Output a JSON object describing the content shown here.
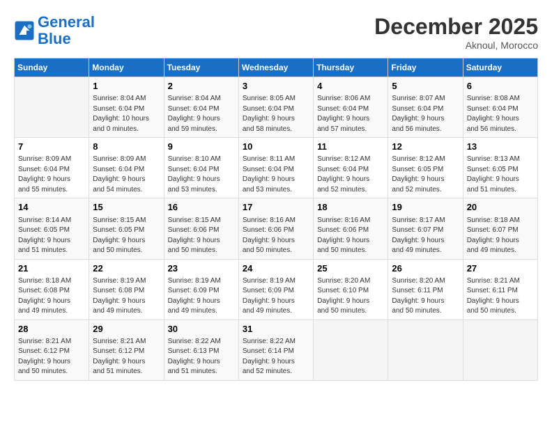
{
  "header": {
    "logo_line1": "General",
    "logo_line2": "Blue",
    "month": "December 2025",
    "location": "Aknoul, Morocco"
  },
  "days_of_week": [
    "Sunday",
    "Monday",
    "Tuesday",
    "Wednesday",
    "Thursday",
    "Friday",
    "Saturday"
  ],
  "weeks": [
    [
      {
        "num": "",
        "info": ""
      },
      {
        "num": "1",
        "info": "Sunrise: 8:04 AM\nSunset: 6:04 PM\nDaylight: 10 hours\nand 0 minutes."
      },
      {
        "num": "2",
        "info": "Sunrise: 8:04 AM\nSunset: 6:04 PM\nDaylight: 9 hours\nand 59 minutes."
      },
      {
        "num": "3",
        "info": "Sunrise: 8:05 AM\nSunset: 6:04 PM\nDaylight: 9 hours\nand 58 minutes."
      },
      {
        "num": "4",
        "info": "Sunrise: 8:06 AM\nSunset: 6:04 PM\nDaylight: 9 hours\nand 57 minutes."
      },
      {
        "num": "5",
        "info": "Sunrise: 8:07 AM\nSunset: 6:04 PM\nDaylight: 9 hours\nand 56 minutes."
      },
      {
        "num": "6",
        "info": "Sunrise: 8:08 AM\nSunset: 6:04 PM\nDaylight: 9 hours\nand 56 minutes."
      }
    ],
    [
      {
        "num": "7",
        "info": "Sunrise: 8:09 AM\nSunset: 6:04 PM\nDaylight: 9 hours\nand 55 minutes."
      },
      {
        "num": "8",
        "info": "Sunrise: 8:09 AM\nSunset: 6:04 PM\nDaylight: 9 hours\nand 54 minutes."
      },
      {
        "num": "9",
        "info": "Sunrise: 8:10 AM\nSunset: 6:04 PM\nDaylight: 9 hours\nand 53 minutes."
      },
      {
        "num": "10",
        "info": "Sunrise: 8:11 AM\nSunset: 6:04 PM\nDaylight: 9 hours\nand 53 minutes."
      },
      {
        "num": "11",
        "info": "Sunrise: 8:12 AM\nSunset: 6:04 PM\nDaylight: 9 hours\nand 52 minutes."
      },
      {
        "num": "12",
        "info": "Sunrise: 8:12 AM\nSunset: 6:05 PM\nDaylight: 9 hours\nand 52 minutes."
      },
      {
        "num": "13",
        "info": "Sunrise: 8:13 AM\nSunset: 6:05 PM\nDaylight: 9 hours\nand 51 minutes."
      }
    ],
    [
      {
        "num": "14",
        "info": "Sunrise: 8:14 AM\nSunset: 6:05 PM\nDaylight: 9 hours\nand 51 minutes."
      },
      {
        "num": "15",
        "info": "Sunrise: 8:15 AM\nSunset: 6:05 PM\nDaylight: 9 hours\nand 50 minutes."
      },
      {
        "num": "16",
        "info": "Sunrise: 8:15 AM\nSunset: 6:06 PM\nDaylight: 9 hours\nand 50 minutes."
      },
      {
        "num": "17",
        "info": "Sunrise: 8:16 AM\nSunset: 6:06 PM\nDaylight: 9 hours\nand 50 minutes."
      },
      {
        "num": "18",
        "info": "Sunrise: 8:16 AM\nSunset: 6:06 PM\nDaylight: 9 hours\nand 50 minutes."
      },
      {
        "num": "19",
        "info": "Sunrise: 8:17 AM\nSunset: 6:07 PM\nDaylight: 9 hours\nand 49 minutes."
      },
      {
        "num": "20",
        "info": "Sunrise: 8:18 AM\nSunset: 6:07 PM\nDaylight: 9 hours\nand 49 minutes."
      }
    ],
    [
      {
        "num": "21",
        "info": "Sunrise: 8:18 AM\nSunset: 6:08 PM\nDaylight: 9 hours\nand 49 minutes."
      },
      {
        "num": "22",
        "info": "Sunrise: 8:19 AM\nSunset: 6:08 PM\nDaylight: 9 hours\nand 49 minutes."
      },
      {
        "num": "23",
        "info": "Sunrise: 8:19 AM\nSunset: 6:09 PM\nDaylight: 9 hours\nand 49 minutes."
      },
      {
        "num": "24",
        "info": "Sunrise: 8:19 AM\nSunset: 6:09 PM\nDaylight: 9 hours\nand 49 minutes."
      },
      {
        "num": "25",
        "info": "Sunrise: 8:20 AM\nSunset: 6:10 PM\nDaylight: 9 hours\nand 50 minutes."
      },
      {
        "num": "26",
        "info": "Sunrise: 8:20 AM\nSunset: 6:11 PM\nDaylight: 9 hours\nand 50 minutes."
      },
      {
        "num": "27",
        "info": "Sunrise: 8:21 AM\nSunset: 6:11 PM\nDaylight: 9 hours\nand 50 minutes."
      }
    ],
    [
      {
        "num": "28",
        "info": "Sunrise: 8:21 AM\nSunset: 6:12 PM\nDaylight: 9 hours\nand 50 minutes."
      },
      {
        "num": "29",
        "info": "Sunrise: 8:21 AM\nSunset: 6:12 PM\nDaylight: 9 hours\nand 51 minutes."
      },
      {
        "num": "30",
        "info": "Sunrise: 8:22 AM\nSunset: 6:13 PM\nDaylight: 9 hours\nand 51 minutes."
      },
      {
        "num": "31",
        "info": "Sunrise: 8:22 AM\nSunset: 6:14 PM\nDaylight: 9 hours\nand 52 minutes."
      },
      {
        "num": "",
        "info": ""
      },
      {
        "num": "",
        "info": ""
      },
      {
        "num": "",
        "info": ""
      }
    ]
  ]
}
